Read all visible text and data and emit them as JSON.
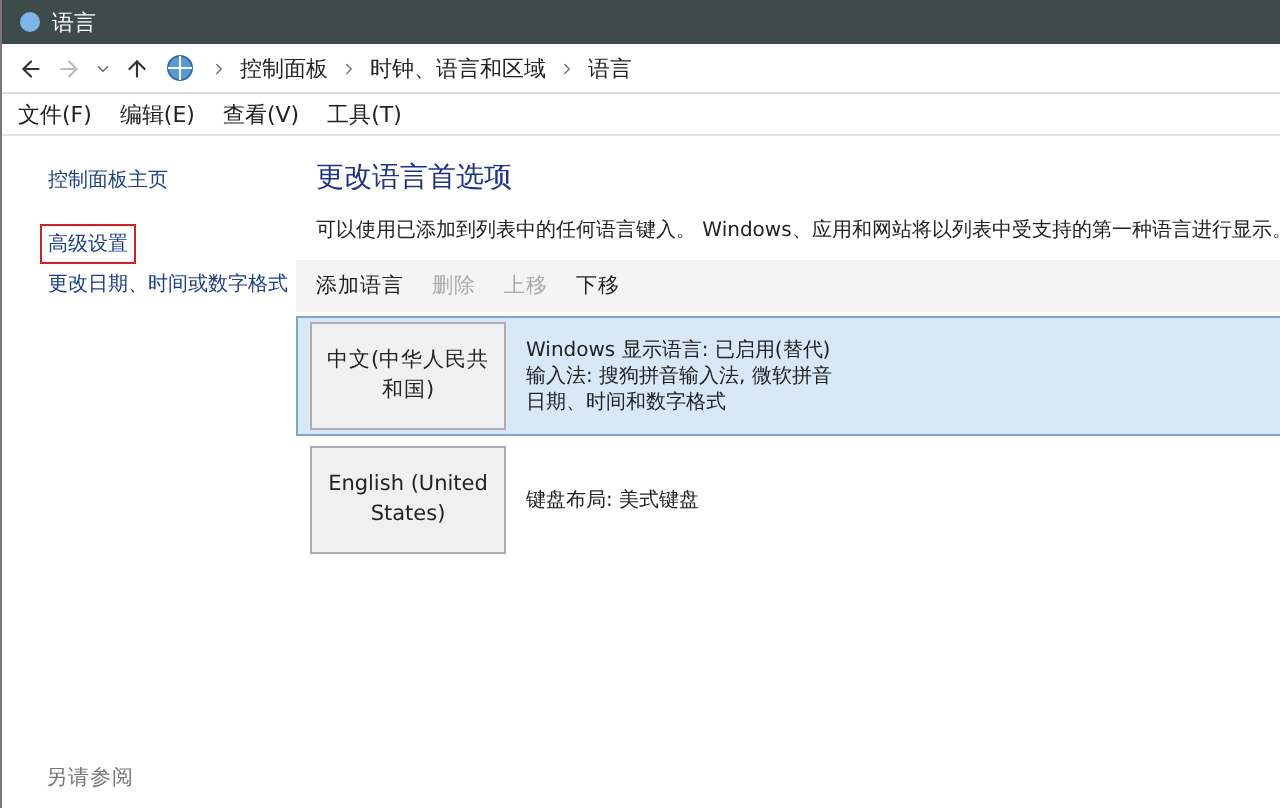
{
  "window": {
    "title": "语言"
  },
  "breadcrumb": [
    "控制面板",
    "时钟、语言和区域",
    "语言"
  ],
  "menu": [
    "文件(F)",
    "编辑(E)",
    "查看(V)",
    "工具(T)"
  ],
  "sidebar": {
    "items": [
      {
        "label": "控制面板主页",
        "marked": false
      },
      {
        "label": "高级设置",
        "marked": true
      },
      {
        "label": "更改日期、时间或数字格式",
        "marked": false
      }
    ],
    "see_also": "另请参阅"
  },
  "main": {
    "heading": "更改语言首选项",
    "description": "可以使用已添加到列表中的任何语言键入。 Windows、应用和网站将以列表中受支持的第一种语言进行显示。",
    "toolbar": [
      {
        "label": "添加语言",
        "disabled": false
      },
      {
        "label": "删除",
        "disabled": true
      },
      {
        "label": "上移",
        "disabled": true
      },
      {
        "label": "下移",
        "disabled": false
      }
    ],
    "languages": [
      {
        "name": "中文(中华人民共和国)",
        "selected": true,
        "details": [
          "Windows 显示语言: 已启用(替代)",
          "输入法: 搜狗拼音输入法, 微软拼音",
          "日期、时间和数字格式"
        ]
      },
      {
        "name": "English (United States)",
        "selected": false,
        "details": [
          "键盘布局: 美式键盘"
        ]
      }
    ]
  }
}
